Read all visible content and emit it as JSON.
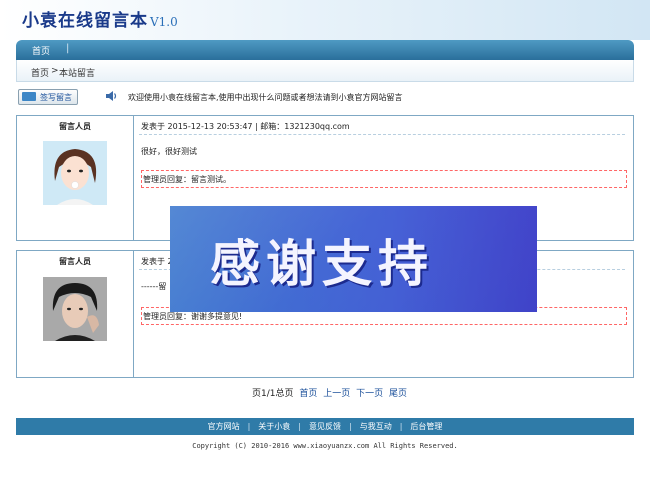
{
  "header": {
    "title": "小袁在线留言本",
    "version": "V1.0"
  },
  "nav": {
    "items": [
      {
        "label": "首页"
      }
    ]
  },
  "breadcrumb": {
    "home": "首页",
    "sep": ">",
    "current": "本站留言"
  },
  "toolbar": {
    "write_label": "签写留言",
    "notice": "欢迎使用小袁在线留言本,使用中出现什么问题或者想法请到小袁官方网站留言"
  },
  "messages": [
    {
      "author_label": "留言人员",
      "posted": "发表于 2015-12-13 20:53:47 | 邮箱：1321230qq.com",
      "body": "很好，很好测试",
      "reply": "管理员回复：留言测试。"
    },
    {
      "author_label": "留言人员",
      "posted": "发表于 2",
      "body": "------留",
      "reply": "管理员回复：谢谢多提意见!"
    }
  ],
  "pager": {
    "summary": "页1/1总页",
    "first": "首页",
    "prev": "上一页",
    "next": "下一页",
    "last": "尾页"
  },
  "footer": {
    "links": [
      "官方网站",
      "关于小袁",
      "意见反馈",
      "与我互动",
      "后台管理"
    ],
    "copyright": "Copyright (C) 2010-2016 www.xiaoyuanzx.com All Rights Reserved."
  },
  "overlay": {
    "text": "感谢支持"
  }
}
